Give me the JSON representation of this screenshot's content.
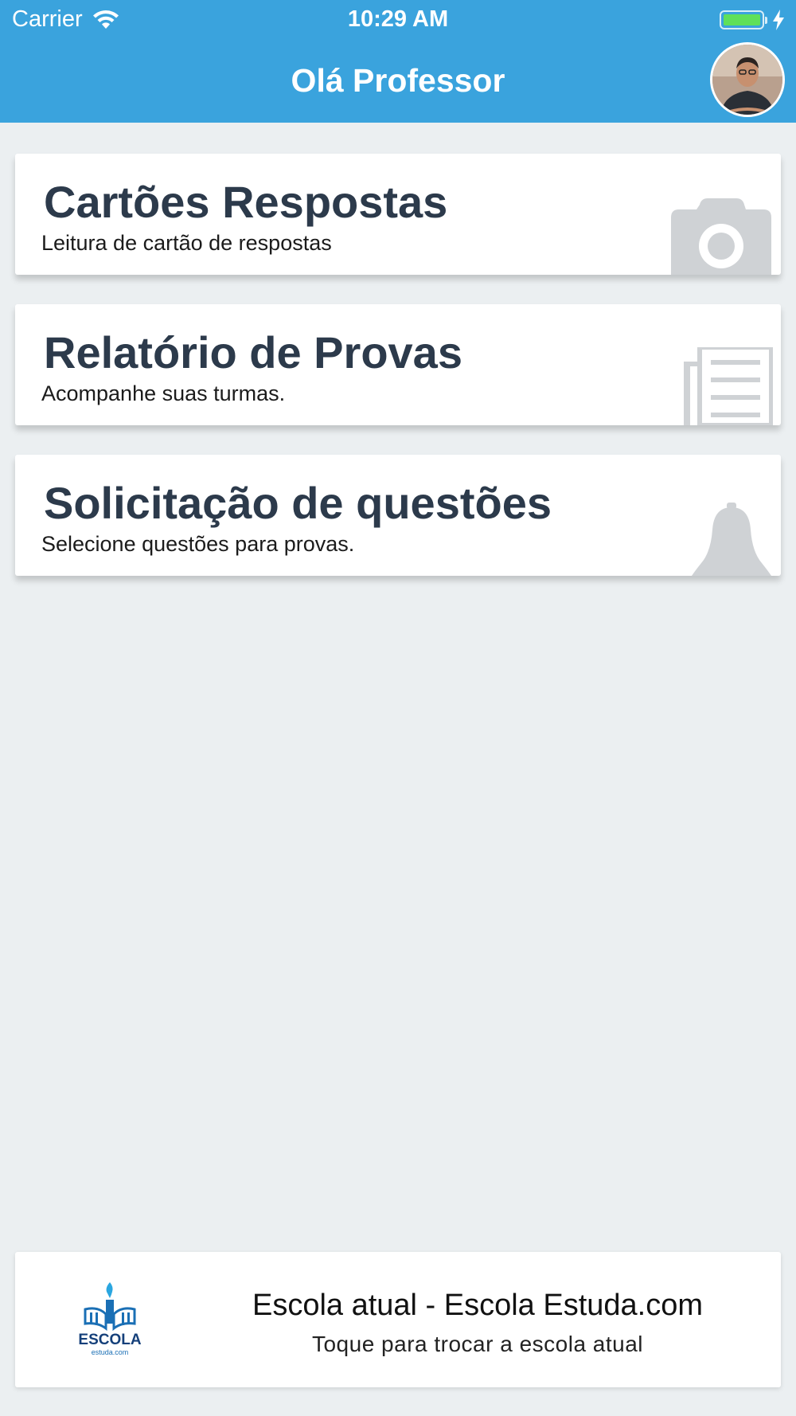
{
  "status_bar": {
    "carrier": "Carrier",
    "time": "10:29 AM",
    "wifi_icon": "wifi-icon",
    "battery_icon": "battery-icon",
    "charging_icon": "bolt-icon",
    "battery_color": "#5fe05a"
  },
  "header": {
    "title": "Olá Professor",
    "background_color": "#3aa3dd",
    "avatar_icon": "user-avatar"
  },
  "menu": {
    "items": [
      {
        "title": "Cartões Respostas",
        "subtitle": "Leitura de cartão de respostas",
        "icon": "camera-icon"
      },
      {
        "title": "Relatório de Provas",
        "subtitle": "Acompanhe suas turmas.",
        "icon": "document-icon"
      },
      {
        "title": "Solicitação de questões",
        "subtitle": "Selecione questões para provas.",
        "icon": "bell-icon"
      }
    ]
  },
  "school": {
    "title": "Escola atual - Escola Estuda.com",
    "subtitle": "Toque para trocar a escola atual",
    "logo_text": "ESCOLA",
    "logo_subtext": "estuda.com",
    "logo_icon": "school-logo"
  },
  "colors": {
    "page_background": "#ebeff1",
    "card_title": "#2c3a4b",
    "icon_gray": "#cfd2d5"
  }
}
